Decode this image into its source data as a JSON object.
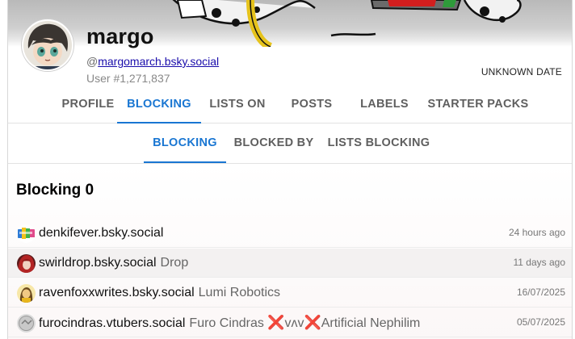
{
  "profile": {
    "display_name": "margo",
    "handle_prefix": "@",
    "handle": "margomarch.bsky.social",
    "user_number": "User #1,271,837",
    "joined": "UNKNOWN DATE",
    "avatar_icon": "avatar-illustration-icon",
    "banner_icon": "banner-illustration-icon"
  },
  "tabs": [
    {
      "label": "PROFILE"
    },
    {
      "label": "BLOCKING"
    },
    {
      "label": "LISTS ON"
    },
    {
      "label": "POSTS"
    },
    {
      "label": "LABELS"
    },
    {
      "label": "STARTER PACKS"
    }
  ],
  "active_tab": "BLOCKING",
  "subtabs": [
    {
      "label": "BLOCKING"
    },
    {
      "label": "BLOCKED BY"
    },
    {
      "label": "LISTS BLOCKING"
    }
  ],
  "active_subtab": "BLOCKING",
  "list": {
    "heading": "Blocking 0",
    "rows": [
      {
        "handle": "denkifever.bsky.social",
        "name": "",
        "time": "24 hours ago",
        "avatar_icon": "pixel-art-avatar-icon"
      },
      {
        "handle": "swirldrop.bsky.social",
        "name": "Drop",
        "time": "11 days ago",
        "avatar_icon": "red-hair-avatar-icon"
      },
      {
        "handle": "ravenfoxxwrites.bsky.social",
        "name": "Lumi Robotics",
        "time": "16/07/2025",
        "avatar_icon": "yellow-character-avatar-icon"
      },
      {
        "handle": "furocindras.vtubers.social",
        "name_part1": "Furo Cindras ",
        "name_mark1": "❌",
        "name_part2": "ᴠʌᴠ",
        "name_mark2": "❌",
        "name_part3": "Artificial Nephilim",
        "time": "05/07/2025",
        "avatar_icon": "logo-avatar-icon"
      }
    ]
  },
  "colors": {
    "accent": "#1976d2",
    "tab_inactive": "#5f5f5f",
    "link": "#1a0dab"
  }
}
